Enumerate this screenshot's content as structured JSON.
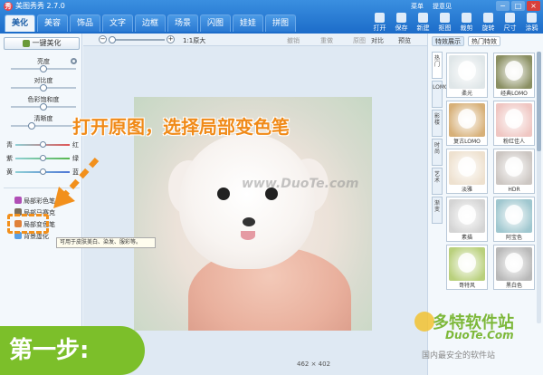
{
  "app": {
    "icon_glyph": "秀",
    "title": "美图秀秀 2.7.0"
  },
  "tabs": [
    "美化",
    "美容",
    "饰品",
    "文字",
    "边框",
    "场景",
    "闪图",
    "娃娃",
    "拼图"
  ],
  "active_tab": "美化",
  "menu": [
    "菜单",
    "提意见"
  ],
  "window_buttons": [
    "−",
    "□",
    "×"
  ],
  "toolbar": [
    "打开",
    "保存",
    "新建",
    "抠图",
    "裁剪",
    "旋转",
    "尺寸",
    "涂鸦",
    "粘贴"
  ],
  "left": {
    "one_key": "一键美化",
    "sliders": [
      {
        "label": "亮度",
        "value": 0.5
      },
      {
        "label": "对比度",
        "value": 0.5
      },
      {
        "label": "色彩饱和度",
        "value": 0.5
      },
      {
        "label": "清晰度",
        "value": 0.3
      }
    ],
    "color_balance": [
      {
        "left": "青",
        "right": "红",
        "value": 0.5,
        "color": "#e05656"
      },
      {
        "left": "紫",
        "right": "绿",
        "value": 0.5,
        "color": "#58b84e"
      },
      {
        "left": "黄",
        "right": "蓝",
        "value": 0.5,
        "color": "#4f78d6"
      }
    ],
    "tools": [
      "局部彩色笔",
      "局部马赛克",
      "局部变色笔",
      "背景虚化"
    ],
    "tool_colors": [
      "#b04eb6",
      "#7a6e5c",
      "#e0813a",
      "#5aa0e6"
    ]
  },
  "canvas": {
    "zoom_minus": "−",
    "zoom_plus": "+",
    "zoom_value": 0.0,
    "ratio_label": "1:1原大",
    "actions": [
      "撤销",
      "重做",
      "原图",
      "对比",
      "预览"
    ],
    "watermark": "www.DuoTe.com",
    "image_size": "462 × 402"
  },
  "right": {
    "tabs": [
      "特效展示",
      "热门特效"
    ],
    "vertical_tabs": [
      "热门",
      "LOMO",
      "影楼",
      "时尚",
      "艺术",
      "渐变"
    ],
    "effects": [
      {
        "label": "柔光",
        "color": "#dfe6e8"
      },
      {
        "label": "经典LOMO",
        "color": "#8a8f62"
      },
      {
        "label": "复古LOMO",
        "color": "#d7b078"
      },
      {
        "label": "粉红佳人",
        "color": "#efc6c2"
      },
      {
        "label": "淡雅",
        "color": "#eee1cf"
      },
      {
        "label": "HDR",
        "color": "#ccc6c2"
      },
      {
        "label": "素描",
        "color": "#d4d4d4"
      },
      {
        "label": "阿宝色",
        "color": "#9fc7cf"
      },
      {
        "label": "哥特风",
        "color": "#b9d07c"
      },
      {
        "label": "黑白色",
        "color": "#b8b8b8"
      }
    ]
  },
  "overlay": {
    "annotation": "打开原图，选择局部变色笔",
    "tooltip": "可用于皮肤美白、染发、服彩等。",
    "step": "第一步:",
    "brand_name": "多特软件站",
    "brand_url": "DuoTe.Com",
    "brand_slogan": "国内最安全的软件站"
  }
}
